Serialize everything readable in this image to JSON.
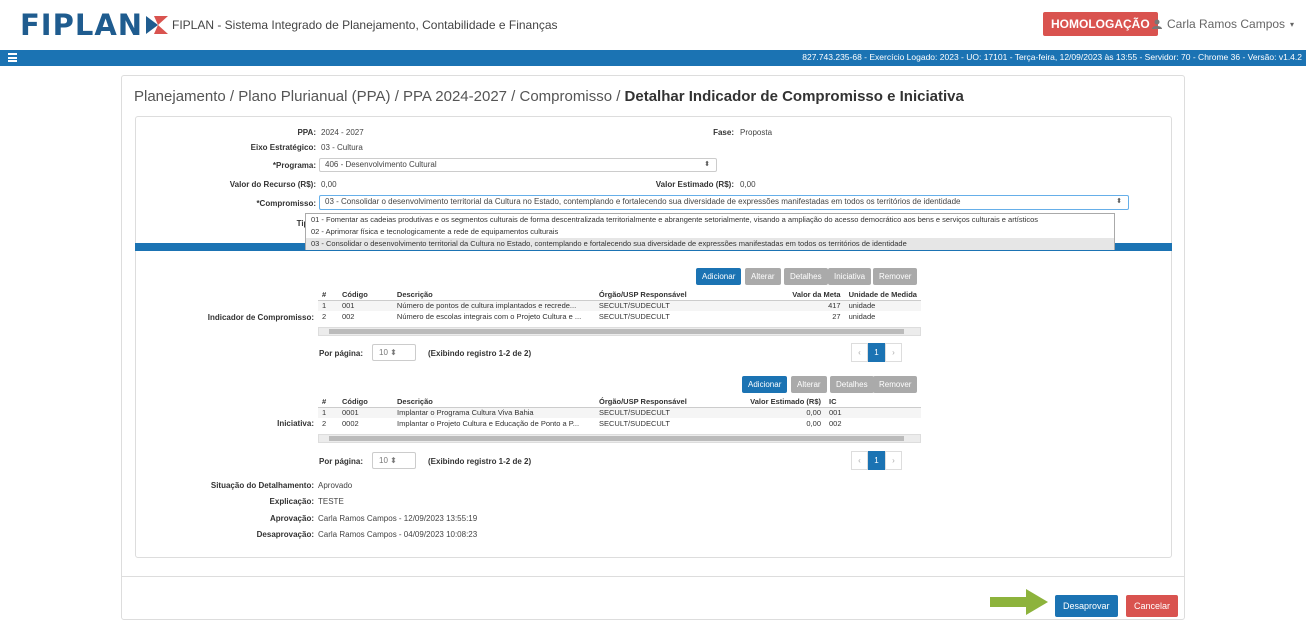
{
  "header": {
    "logo_text": "FIPLAN",
    "app_title": "FIPLAN - Sistema Integrado de Planejamento, Contabilidade e Finanças",
    "env_badge": "HOMOLOGAÇÃO",
    "user_name": "Carla Ramos Campos",
    "colors": {
      "brand": "#1f5c8f",
      "badge": "#d9534f",
      "nav": "#1b73b3"
    }
  },
  "navbar": {
    "status_line": "827.743.235-68 - Exercício Logado: 2023 - UO: 17101 - Terça-feira, 12/09/2023 às 13:55 - Servidor: 70 - Chrome 36 - Versão: v1.4.2"
  },
  "breadcrumb": {
    "path": "Planejamento / Plano Plurianual (PPA) / PPA 2024-2027 / Compromisso / ",
    "current": "Detalhar Indicador de Compromisso e Iniciativa"
  },
  "form": {
    "ppa_label": "PPA:",
    "ppa_value": "2024 - 2027",
    "fase_label": "Fase:",
    "fase_value": "Proposta",
    "eixo_label": "Eixo Estratégico:",
    "eixo_value": "03 - Cultura",
    "programa_label": "*Programa:",
    "programa_value": "406 - Desenvolvimento Cultural",
    "valor_recurso_label": "Valor do Recurso (R$):",
    "valor_recurso_value": "0,00",
    "valor_estimado_label": "Valor Estimado (R$):",
    "valor_estimado_value": "0,00",
    "compromisso_label": "*Compromisso:",
    "compromisso_value": "03 - Consolidar o desenvolvimento territorial da Cultura no Estado, contemplando e fortalecendo sua diversidade de expressões manifestadas em todos os territórios de identidade",
    "tipo_label": "Tipo:",
    "compromisso_options": [
      "01 - Fomentar as cadeias produtivas e os segmentos culturais de forma descentralizada territorialmente e abrangente setorialmente, visando a ampliação do acesso democrático aos bens e serviços culturais e artísticos",
      "02 - Aprimorar física e tecnologicamente a rede de equipamentos culturais",
      "03 - Consolidar o desenvolvimento territorial da Cultura no Estado, contemplando e fortalecendo sua diversidade de expressões manifestadas em todos os territórios de identidade"
    ]
  },
  "indicador": {
    "section_label": "Indicador de Compromisso:",
    "buttons": {
      "add": "Adicionar",
      "edit": "Alterar",
      "details": "Detalhes",
      "iniciativa": "Iniciativa",
      "remove": "Remover"
    },
    "columns": [
      "#",
      "Código",
      "Descrição",
      "Órgão/USP Responsável",
      "Valor da Meta",
      "Unidade de Medida"
    ],
    "rows": [
      [
        "1",
        "001",
        "Número de pontos de cultura implantados e recrede...",
        "SECULT/SUDECULT",
        "417",
        "unidade"
      ],
      [
        "2",
        "002",
        "Número de escolas integrais com o Projeto Cultura e ...",
        "SECULT/SUDECULT",
        "27",
        "unidade"
      ]
    ],
    "per_page_label": "Por página:",
    "per_page_value": "10",
    "showing": "(Exibindo registro 1-2 de 2)",
    "page": "1"
  },
  "iniciativa": {
    "section_label": "Iniciativa:",
    "buttons": {
      "add": "Adicionar",
      "edit": "Alterar",
      "details": "Detalhes",
      "remove": "Remover"
    },
    "columns": [
      "#",
      "Código",
      "Descrição",
      "Órgão/USP Responsável",
      "Valor Estimado (R$)",
      "IC"
    ],
    "rows": [
      [
        "1",
        "0001",
        "Implantar o Programa Cultura Viva Bahia",
        "SECULT/SUDECULT",
        "0,00",
        "001"
      ],
      [
        "2",
        "0002",
        "Implantar o Projeto Cultura e Educação de Ponto a P...",
        "SECULT/SUDECULT",
        "0,00",
        "002"
      ]
    ],
    "per_page_label": "Por página:",
    "per_page_value": "10",
    "showing": "(Exibindo registro 1-2 de 2)",
    "page": "1"
  },
  "detalhamento": {
    "situacao_label": "Situação do Detalhamento:",
    "situacao_value": "Aprovado",
    "explicacao_label": "Explicação:",
    "explicacao_value": "TESTE",
    "aprovacao_label": "Aprovação:",
    "aprovacao_value": "Carla Ramos Campos - 12/09/2023 13:55:19",
    "desaprovacao_label": "Desaprovação:",
    "desaprovacao_value": "Carla Ramos Campos - 04/09/2023 10:08:23"
  },
  "actions": {
    "disapprove": "Desaprovar",
    "cancel": "Cancelar",
    "arrow_color": "#8db33c"
  }
}
